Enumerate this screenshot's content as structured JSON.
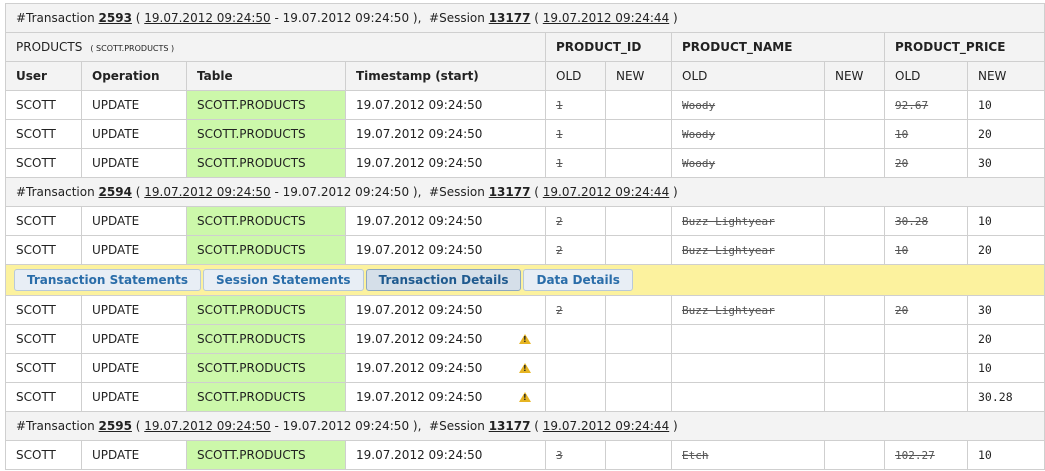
{
  "labels": {
    "transaction_prefix": "#Transaction",
    "session_prefix": "#Session",
    "products": "PRODUCTS",
    "products_table": "( SCOTT.PRODUCTS )"
  },
  "columns": {
    "product_id": "PRODUCT_ID",
    "product_name": "PRODUCT_NAME",
    "product_price": "PRODUCT_PRICE",
    "user": "User",
    "operation": "Operation",
    "table": "Table",
    "timestamp": "Timestamp (start)",
    "old": "OLD",
    "new": "NEW"
  },
  "transactions": [
    {
      "id": "2593",
      "start": "19.07.2012 09:24:50",
      "end": "19.07.2012 09:24:50",
      "session": "13177",
      "session_time": "19.07.2012 09:24:44",
      "rows": [
        {
          "user": "SCOTT",
          "operation": "UPDATE",
          "table": "SCOTT.PRODUCTS",
          "timestamp": "19.07.2012 09:24:50",
          "id_old": "1",
          "id_new": "",
          "name_old": "Woody",
          "name_new": "",
          "price_old": "92.67",
          "price_new": "10",
          "warn": false
        },
        {
          "user": "SCOTT",
          "operation": "UPDATE",
          "table": "SCOTT.PRODUCTS",
          "timestamp": "19.07.2012 09:24:50",
          "id_old": "1",
          "id_new": "",
          "name_old": "Woody",
          "name_new": "",
          "price_old": "10",
          "price_new": "20",
          "warn": false
        },
        {
          "user": "SCOTT",
          "operation": "UPDATE",
          "table": "SCOTT.PRODUCTS",
          "timestamp": "19.07.2012 09:24:50",
          "id_old": "1",
          "id_new": "",
          "name_old": "Woody",
          "name_new": "",
          "price_old": "20",
          "price_new": "30",
          "warn": false
        }
      ]
    },
    {
      "id": "2594",
      "start": "19.07.2012 09:24:50",
      "end": "19.07.2012 09:24:50",
      "session": "13177",
      "session_time": "19.07.2012 09:24:44",
      "rows": [
        {
          "user": "SCOTT",
          "operation": "UPDATE",
          "table": "SCOTT.PRODUCTS",
          "timestamp": "19.07.2012 09:24:50",
          "id_old": "2",
          "id_new": "",
          "name_old": "Buzz Lightyear",
          "name_new": "",
          "price_old": "30.28",
          "price_new": "10",
          "warn": false
        },
        {
          "user": "SCOTT",
          "operation": "UPDATE",
          "table": "SCOTT.PRODUCTS",
          "timestamp": "19.07.2012 09:24:50",
          "id_old": "2",
          "id_new": "",
          "name_old": "Buzz Lightyear",
          "name_new": "",
          "price_old": "10",
          "price_new": "20",
          "warn": false
        }
      ],
      "actions": [
        "Transaction Statements",
        "Session Statements",
        "Transaction Details",
        "Data Details"
      ],
      "active_action": 2,
      "rows_after": [
        {
          "user": "SCOTT",
          "operation": "UPDATE",
          "table": "SCOTT.PRODUCTS",
          "timestamp": "19.07.2012 09:24:50",
          "id_old": "2",
          "id_new": "",
          "name_old": "Buzz Lightyear",
          "name_new": "",
          "price_old": "20",
          "price_new": "30",
          "warn": false
        },
        {
          "user": "SCOTT",
          "operation": "UPDATE",
          "table": "SCOTT.PRODUCTS",
          "timestamp": "19.07.2012 09:24:50",
          "id_old": "",
          "id_new": "",
          "name_old": "",
          "name_new": "",
          "price_old": "",
          "price_new": "20",
          "warn": true
        },
        {
          "user": "SCOTT",
          "operation": "UPDATE",
          "table": "SCOTT.PRODUCTS",
          "timestamp": "19.07.2012 09:24:50",
          "id_old": "",
          "id_new": "",
          "name_old": "",
          "name_new": "",
          "price_old": "",
          "price_new": "10",
          "warn": true
        },
        {
          "user": "SCOTT",
          "operation": "UPDATE",
          "table": "SCOTT.PRODUCTS",
          "timestamp": "19.07.2012 09:24:50",
          "id_old": "",
          "id_new": "",
          "name_old": "",
          "name_new": "",
          "price_old": "",
          "price_new": "30.28",
          "warn": true
        }
      ]
    },
    {
      "id": "2595",
      "start": "19.07.2012 09:24:50",
      "end": "19.07.2012 09:24:50",
      "session": "13177",
      "session_time": "19.07.2012 09:24:44",
      "rows": [
        {
          "user": "SCOTT",
          "operation": "UPDATE",
          "table": "SCOTT.PRODUCTS",
          "timestamp": "19.07.2012 09:24:50",
          "id_old": "3",
          "id_new": "",
          "name_old": "Etch",
          "name_new": "",
          "price_old": "102.27",
          "price_new": "10",
          "warn": false
        }
      ]
    }
  ],
  "colors": {
    "table_cell": "#ccf8aa",
    "action_bar": "#fcf29e",
    "header_bg": "#f3f3f3",
    "warning": "#e6b422",
    "button_text": "#2a6da9"
  },
  "icons": {
    "warning": "warning-icon"
  }
}
